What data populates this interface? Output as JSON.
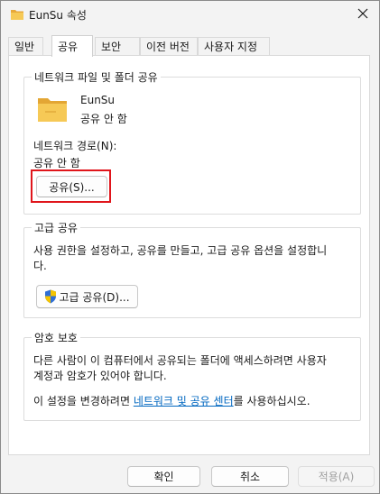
{
  "window": {
    "title": "EunSu 속성",
    "close_glyph": "✕"
  },
  "tabs": [
    {
      "label": "일반",
      "active": false
    },
    {
      "label": "공유",
      "active": true
    },
    {
      "label": "보안",
      "active": false
    },
    {
      "label": "이전 버전",
      "active": false
    },
    {
      "label": "사용자 지정",
      "active": false
    }
  ],
  "network_share": {
    "group_title": "네트워크 파일 및 폴더 공유",
    "folder_name": "EunSu",
    "share_status": "공유 안 함",
    "path_label": "네트워크 경로(N):",
    "path_value": "공유 안 함",
    "share_button": "공유(S)..."
  },
  "advanced_share": {
    "group_title": "고급 공유",
    "description_line1": "사용 권한을 설정하고, 공유를 만들고, 고급 공유 옵션을 설정합니",
    "description_line2": "다.",
    "button": "고급 공유(D)..."
  },
  "password_protection": {
    "group_title": "암호 보호",
    "line1": "다른 사람이 이 컴퓨터에서 공유되는 폴더에 액세스하려면 사용자",
    "line2": "계정과 암호가 있어야 합니다.",
    "line3_prefix": "이 설정을 변경하려면 ",
    "link_text": "네트워크 및 공유 센터",
    "line3_suffix": "를 사용하십시오."
  },
  "footer": {
    "ok": "확인",
    "cancel": "취소",
    "apply": "적용(A)"
  },
  "colors": {
    "highlight": "#e0151b",
    "link": "#0067c0",
    "folder": "#f2c14e",
    "shield_blue": "#2f6fd6",
    "shield_yellow": "#f5c400"
  }
}
